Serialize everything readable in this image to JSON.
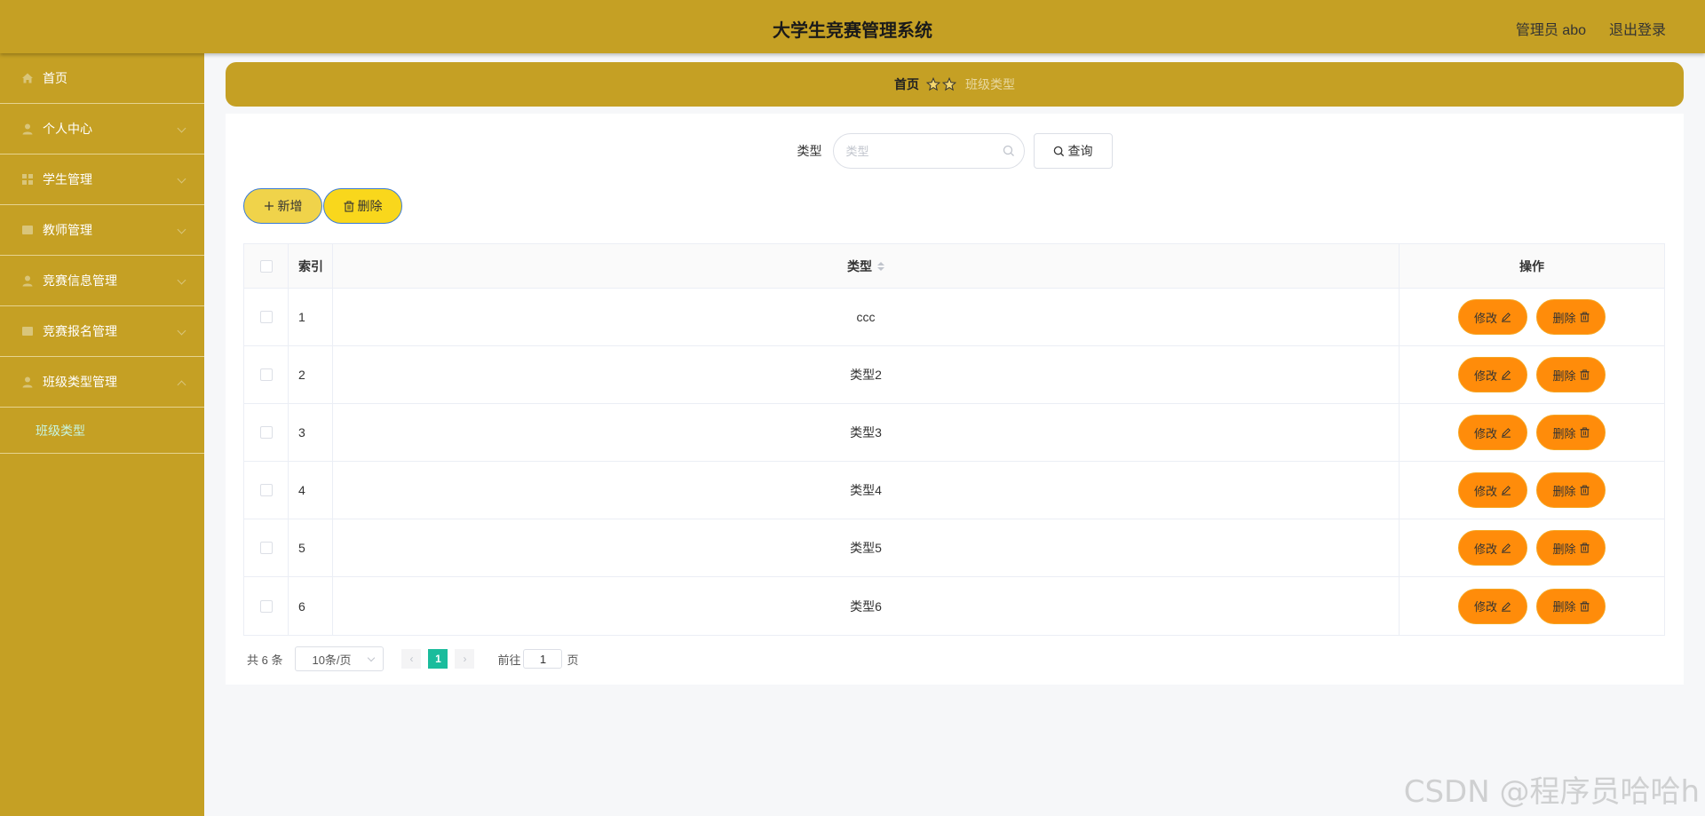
{
  "app": {
    "title": "大学生竞赛管理系统"
  },
  "header": {
    "user": "管理员 abo",
    "logout": "退出登录"
  },
  "sidebar": {
    "items": [
      {
        "label": "首页",
        "icon": "home-icon"
      },
      {
        "label": "个人中心",
        "icon": "user-icon"
      },
      {
        "label": "学生管理",
        "icon": "grid-icon"
      },
      {
        "label": "教师管理",
        "icon": "folder-icon"
      },
      {
        "label": "竞赛信息管理",
        "icon": "user-icon"
      },
      {
        "label": "竞赛报名管理",
        "icon": "folder-icon"
      },
      {
        "label": "班级类型管理",
        "icon": "user-icon"
      }
    ],
    "submenu": "班级类型"
  },
  "breadcrumb": {
    "home": "首页",
    "current": "班级类型"
  },
  "search": {
    "label": "类型",
    "placeholder": "类型",
    "button": "查询"
  },
  "actions": {
    "add": "新增",
    "delete": "删除"
  },
  "table": {
    "headers": {
      "index": "索引",
      "type": "类型",
      "ops": "操作"
    },
    "edit_label": "修改",
    "delete_label": "删除",
    "rows": [
      {
        "index": "1",
        "type": "ccc"
      },
      {
        "index": "2",
        "type": "类型2"
      },
      {
        "index": "3",
        "type": "类型3"
      },
      {
        "index": "4",
        "type": "类型4"
      },
      {
        "index": "5",
        "type": "类型5"
      },
      {
        "index": "6",
        "type": "类型6"
      }
    ]
  },
  "pagination": {
    "total": "共 6 条",
    "page_size": "10条/页",
    "current": "1",
    "goto": "前往",
    "goto_value": "1",
    "page_suffix": "页"
  },
  "watermark": "CSDN @程序员哈哈h",
  "colors": {
    "primary": "#c5a024",
    "action": "#ff8c0a",
    "pager_active": "#1abc9c"
  }
}
